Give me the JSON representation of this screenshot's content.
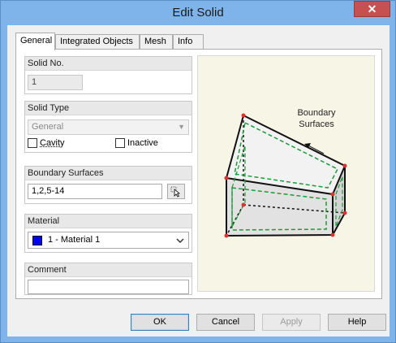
{
  "window": {
    "title": "Edit Solid",
    "close_glyph": "✕"
  },
  "tabs": [
    {
      "label": "General"
    },
    {
      "label": "Integrated Objects"
    },
    {
      "label": "Mesh"
    },
    {
      "label": "Info"
    }
  ],
  "solid_no": {
    "header": "Solid No.",
    "value": "1"
  },
  "solid_type": {
    "header": "Solid Type",
    "selected": "General",
    "cavity_label": "Cavity",
    "inactive_label": "Inactive"
  },
  "boundary_surfaces": {
    "header": "Boundary Surfaces",
    "value": "1,2,5-14",
    "pick_icon": "pick-cursor-icon"
  },
  "material": {
    "header": "Material",
    "selected": "1 - Material 1",
    "swatch_color": "#0000ff"
  },
  "comment": {
    "header": "Comment",
    "value": ""
  },
  "preview": {
    "callout_line1": "Boundary",
    "callout_line2": "Surfaces"
  },
  "buttons": {
    "ok": "OK",
    "cancel": "Cancel",
    "apply": "Apply",
    "help": "Help"
  },
  "colors": {
    "titlebar": "#7eb4ea",
    "close": "#c75050",
    "dashed": "#1f9a3a",
    "vertex": "#e03030"
  }
}
